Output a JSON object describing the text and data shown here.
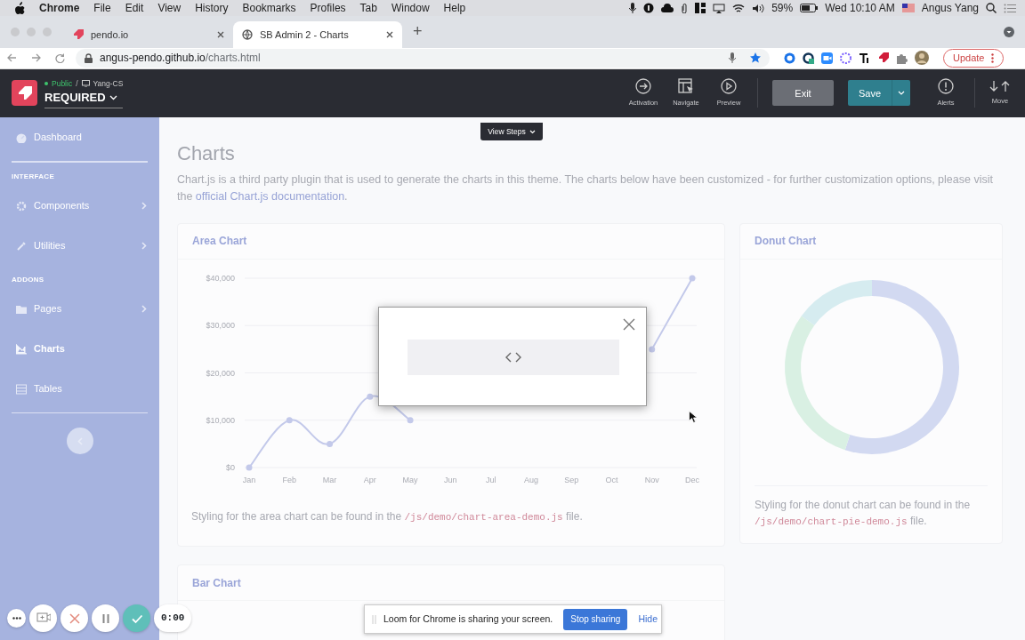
{
  "menu_bar": {
    "app": "Chrome",
    "menus": [
      "File",
      "Edit",
      "View",
      "History",
      "Bookmarks",
      "Profiles",
      "Tab",
      "Window",
      "Help"
    ],
    "battery": "59%",
    "clock": "Wed 10:10 AM",
    "user": "Angus Yang"
  },
  "browser": {
    "tabs": [
      {
        "title": "pendo.io",
        "selected": false
      },
      {
        "title": "SB Admin 2 - Charts",
        "selected": true
      }
    ],
    "new_tab": "+",
    "url_host": "angus-pendo.github.io",
    "url_path": "/charts.html",
    "update_button": "Update"
  },
  "designer_bar": {
    "visibility": "Public",
    "separator": "/",
    "segment": "Yang-CS",
    "guide_name": "REQUIRED",
    "tools": [
      {
        "label": "Activation"
      },
      {
        "label": "Navigate"
      },
      {
        "label": "Preview"
      }
    ],
    "exit_button": "Exit",
    "save_button": "Save",
    "alerts": "Alerts",
    "move": "Move",
    "view_steps": "View Steps"
  },
  "sidebar": {
    "items": [
      {
        "kind": "link",
        "label": "Dashboard",
        "expandable": false,
        "selected": false
      },
      {
        "kind": "heading",
        "label": "INTERFACE"
      },
      {
        "kind": "link",
        "label": "Components",
        "expandable": true,
        "selected": false
      },
      {
        "kind": "link",
        "label": "Utilities",
        "expandable": true,
        "selected": false
      },
      {
        "kind": "heading",
        "label": "ADDONS"
      },
      {
        "kind": "link",
        "label": "Pages",
        "expandable": true,
        "selected": false
      },
      {
        "kind": "link",
        "label": "Charts",
        "expandable": false,
        "selected": true
      },
      {
        "kind": "link",
        "label": "Tables",
        "expandable": false,
        "selected": false
      }
    ]
  },
  "page": {
    "title": "Charts",
    "intro": "Chart.js is a third party plugin that is used to generate the charts in this theme. The charts below have been customized - for further customization options, please visit the",
    "intro_link": "official Chart.js documentation",
    "intro_end": "."
  },
  "area_card": {
    "title": "Area Chart",
    "chart_data": {
      "type": "line",
      "categories": [
        "Jan",
        "Feb",
        "Mar",
        "Apr",
        "May",
        "Jun",
        "Jul",
        "Aug",
        "Sep",
        "Oct",
        "Nov",
        "Dec"
      ],
      "marker": true,
      "grid": true,
      "values": [
        0,
        10000,
        5000,
        15000,
        10000,
        null,
        null,
        null,
        null,
        null,
        25000,
        40000
      ],
      "ylim": [
        0,
        40000
      ],
      "yticks": [
        {
          "value": 0,
          "label": "$0"
        },
        {
          "value": 10000,
          "label": "$10,000"
        },
        {
          "value": 20000,
          "label": "$20,000"
        },
        {
          "value": 30000,
          "label": "$30,000"
        },
        {
          "value": 40000,
          "label": "$40,000"
        }
      ]
    },
    "caption_before": "Styling for the area chart can be found in the",
    "caption_code": "/js/demo/chart-area-demo.js",
    "caption_after": "file."
  },
  "donut_card": {
    "title": "Donut Chart",
    "caption_before": "Styling for the donut chart can be found in the",
    "caption_code": "/js/demo/chart-pie-demo.js",
    "caption_after": "file."
  },
  "bar_card": {
    "title": "Bar Chart"
  },
  "loom_banner": {
    "message": "Loom for Chrome is sharing your screen.",
    "stop_button": "Stop sharing",
    "hide_link": "Hide"
  },
  "loom_controls": {
    "timer": "0:00"
  }
}
